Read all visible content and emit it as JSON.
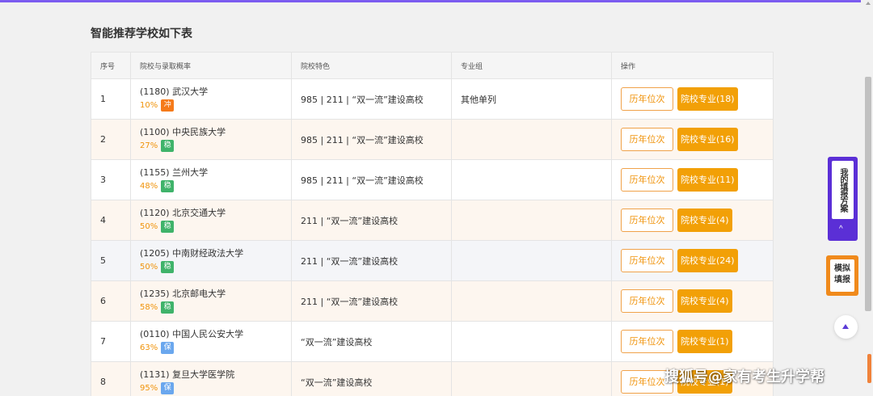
{
  "page_title": "智能推荐学校如下表",
  "table": {
    "headers": [
      "序号",
      "院校与录取概率",
      "院校特色",
      "专业组",
      "操作"
    ],
    "history_label": "历年位次",
    "rows": [
      {
        "index": "1",
        "school": "(1180) 武汉大学",
        "prob": "10%",
        "tag": "冲",
        "tag_type": "chong",
        "feature": "985 | 211 | “双一流”建设高校",
        "group": "其他单列",
        "majors": "院校专业(18)"
      },
      {
        "index": "2",
        "school": "(1100) 中央民族大学",
        "prob": "27%",
        "tag": "稳",
        "tag_type": "wen",
        "feature": "985 | 211 | “双一流”建设高校",
        "group": "",
        "majors": "院校专业(16)"
      },
      {
        "index": "3",
        "school": "(1155) 兰州大学",
        "prob": "48%",
        "tag": "稳",
        "tag_type": "wen",
        "feature": "985 | 211 | “双一流”建设高校",
        "group": "",
        "majors": "院校专业(11)"
      },
      {
        "index": "4",
        "school": "(1120) 北京交通大学",
        "prob": "50%",
        "tag": "稳",
        "tag_type": "wen",
        "feature": "211 | “双一流”建设高校",
        "group": "",
        "majors": "院校专业(4)"
      },
      {
        "index": "5",
        "school": "(1205) 中南财经政法大学",
        "prob": "50%",
        "tag": "稳",
        "tag_type": "wen",
        "feature": "211 | “双一流”建设高校",
        "group": "",
        "majors": "院校专业(24)"
      },
      {
        "index": "6",
        "school": "(1235) 北京邮电大学",
        "prob": "58%",
        "tag": "稳",
        "tag_type": "wen",
        "feature": "211 | “双一流”建设高校",
        "group": "",
        "majors": "院校专业(4)"
      },
      {
        "index": "7",
        "school": "(0110) 中国人民公安大学",
        "prob": "63%",
        "tag": "保",
        "tag_type": "bao",
        "feature": "“双一流”建设高校",
        "group": "",
        "majors": "院校专业(1)"
      },
      {
        "index": "8",
        "school": "(1131) 复旦大学医学院",
        "prob": "95%",
        "tag": "保",
        "tag_type": "bao",
        "feature": "“双一流”建设高校",
        "group": "",
        "majors": "院校专业(1)"
      }
    ]
  },
  "side": {
    "plan_label": "我的填报方案",
    "plan_arrow": "^",
    "mock_line1": "模拟",
    "mock_line2": "填报"
  },
  "watermark": "搜狐号@家有考生升学帮",
  "colors": {
    "accent_purple": "#5b2fd6",
    "orange": "#f2a007",
    "tag_chong": "#f57a1a",
    "tag_wen": "#3fb36a",
    "tag_bao": "#6aa7ee"
  }
}
